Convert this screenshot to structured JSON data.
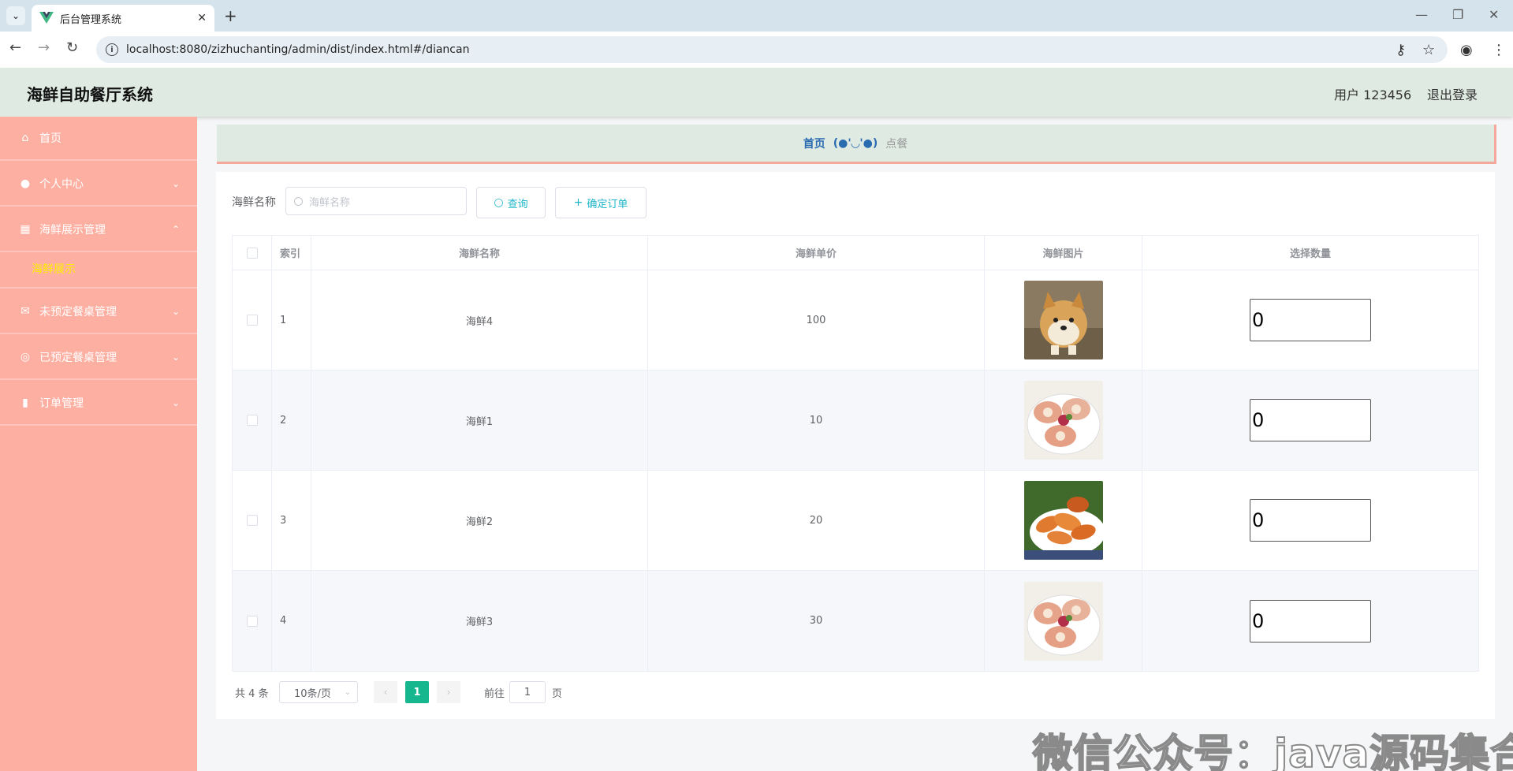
{
  "browser": {
    "tab_title": "后台管理系统",
    "url": "localhost:8080/zizhuchanting/admin/dist/index.html#/diancan"
  },
  "header": {
    "app_title": "海鲜自助餐厅系统",
    "user_label": "用户 123456",
    "logout_label": "退出登录"
  },
  "sidebar": {
    "items": [
      {
        "label": "首页",
        "icon": "home-icon"
      },
      {
        "label": "个人中心",
        "icon": "user-icon"
      },
      {
        "label": "海鲜展示管理",
        "icon": "grid-icon"
      },
      {
        "label": "未预定餐桌管理",
        "icon": "mail-icon"
      },
      {
        "label": "已预定餐桌管理",
        "icon": "compass-icon"
      },
      {
        "label": "订单管理",
        "icon": "bar-chart-icon"
      }
    ],
    "sub_item": "海鲜展示",
    "colors": {
      "background": "#fdafa2",
      "active_sub": "#ffee00"
    }
  },
  "breadcrumb": {
    "home": "首页",
    "face": "(●'◡'●)",
    "current": "点餐"
  },
  "search": {
    "label": "海鲜名称",
    "placeholder": "海鲜名称",
    "query_button": "查询",
    "confirm_button": "确定订单"
  },
  "table": {
    "headers": [
      "索引",
      "海鲜名称",
      "海鲜单价",
      "海鲜图片",
      "选择数量"
    ],
    "rows": [
      {
        "index": "1",
        "name": "海鲜4",
        "price": "100",
        "image": "shiba-dog",
        "qty": "0"
      },
      {
        "index": "2",
        "name": "海鲜1",
        "price": "10",
        "image": "scallops",
        "qty": "0"
      },
      {
        "index": "3",
        "name": "海鲜2",
        "price": "20",
        "image": "shrimp",
        "qty": "0"
      },
      {
        "index": "4",
        "name": "海鲜3",
        "price": "30",
        "image": "scallops",
        "qty": "0"
      }
    ]
  },
  "pagination": {
    "total": "共 4 条",
    "page_size": "10条/页",
    "current_page": "1",
    "goto_label": "前往",
    "goto_value": "1",
    "page_suffix": "页"
  },
  "watermark": "微信公众号：java源码集合",
  "colors": {
    "accent": "#16b68f",
    "header_bg": "#dfeae3",
    "button_text": "#1fb6c9"
  }
}
